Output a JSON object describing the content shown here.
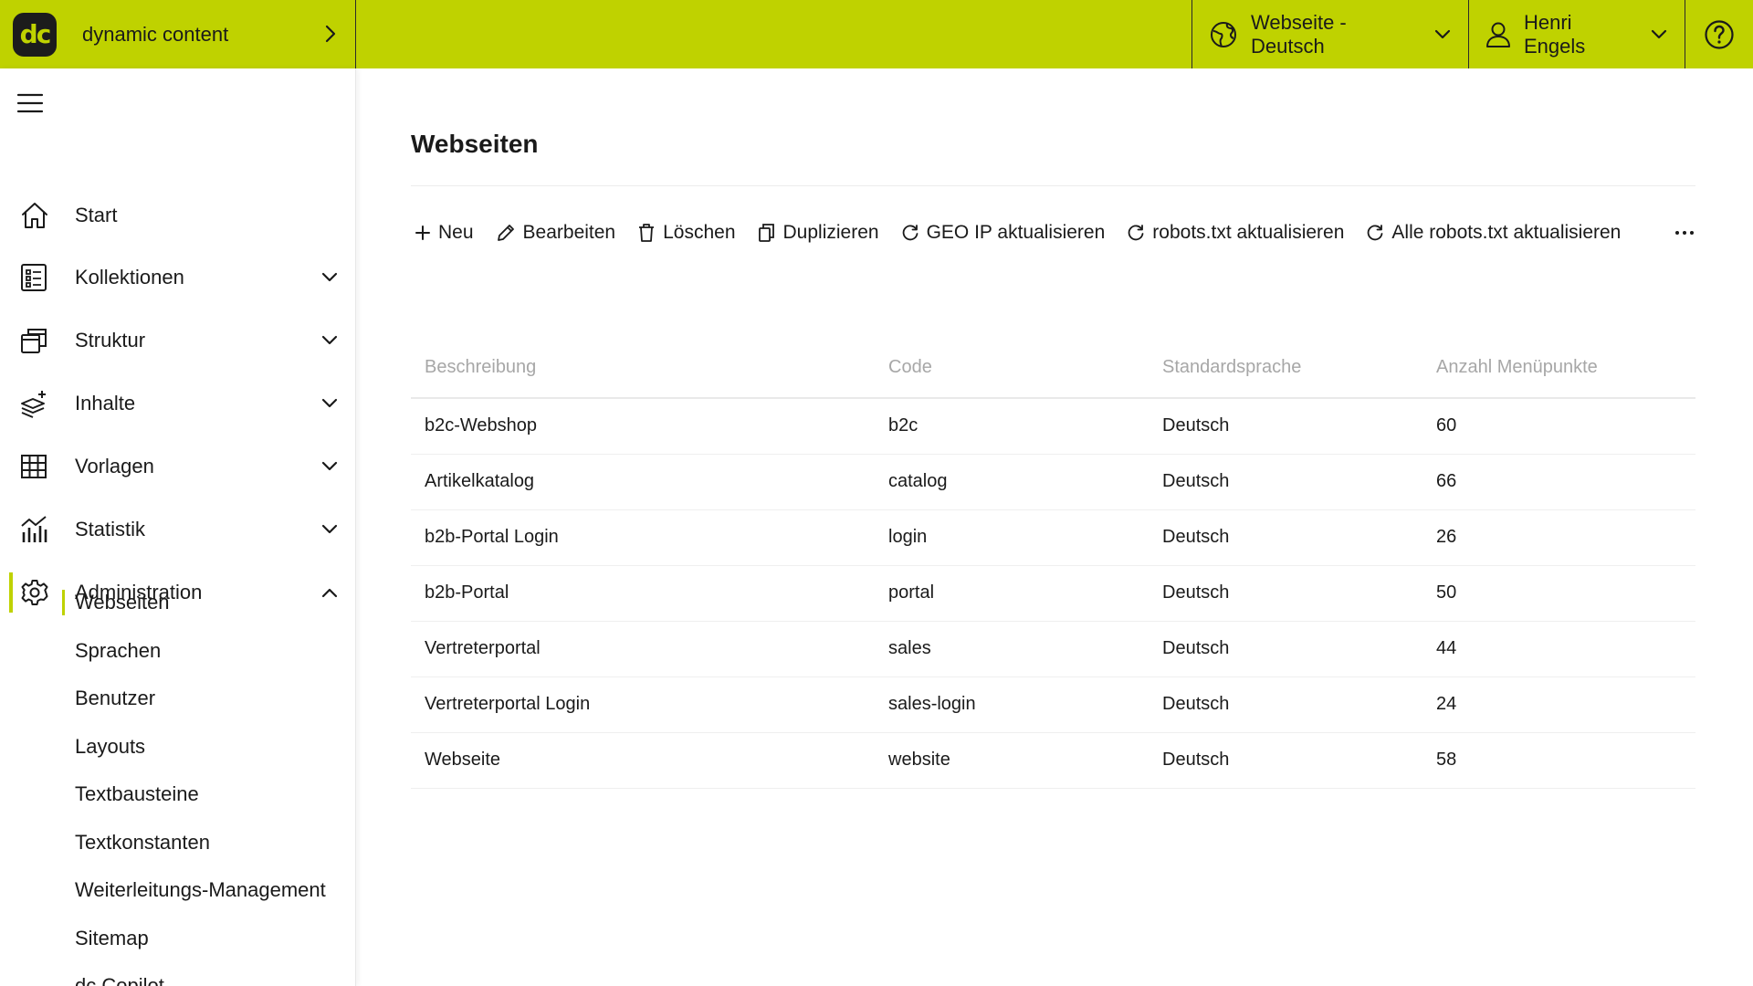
{
  "app": {
    "brand_name": "dynamic content",
    "logo_text": "dc",
    "accent_color": "#bfd200"
  },
  "header": {
    "website_selector": "Webseite - Deutsch",
    "user_name": "Henri Engels",
    "help_icon": "help-circle-icon"
  },
  "sidebar": {
    "items": [
      {
        "label": "Start",
        "icon": "home-icon"
      },
      {
        "label": "Kollektionen",
        "icon": "list-icon"
      },
      {
        "label": "Struktur",
        "icon": "windows-icon"
      },
      {
        "label": "Inhalte",
        "icon": "layers-plus-icon"
      },
      {
        "label": "Vorlagen",
        "icon": "grid-icon"
      },
      {
        "label": "Statistik",
        "icon": "chart-icon"
      },
      {
        "label": "Administration",
        "icon": "gear-icon"
      }
    ],
    "admin_subitems": [
      "Webseiten",
      "Sprachen",
      "Benutzer",
      "Layouts",
      "Textbausteine",
      "Textkonstanten",
      "Weiterleitungs-Management",
      "Sitemap",
      "dc Copilot"
    ]
  },
  "main": {
    "title": "Webseiten",
    "toolbar": {
      "new": "Neu",
      "edit": "Bearbeiten",
      "delete": "Löschen",
      "duplicate": "Duplizieren",
      "geo_ip": "GEO IP aktualisieren",
      "robots": "robots.txt aktualisieren",
      "all_robots": "Alle robots.txt aktualisieren"
    },
    "table": {
      "headers": [
        "Beschreibung",
        "Code",
        "Standardsprache",
        "Anzahl Menüpunkte"
      ],
      "rows": [
        [
          "b2c-Webshop",
          "b2c",
          "Deutsch",
          "60"
        ],
        [
          "Artikelkatalog",
          "catalog",
          "Deutsch",
          "66"
        ],
        [
          "b2b-Portal Login",
          "login",
          "Deutsch",
          "26"
        ],
        [
          "b2b-Portal",
          "portal",
          "Deutsch",
          "50"
        ],
        [
          "Vertreterportal",
          "sales",
          "Deutsch",
          "44"
        ],
        [
          "Vertreterportal Login",
          "sales-login",
          "Deutsch",
          "24"
        ],
        [
          "Webseite",
          "website",
          "Deutsch",
          "58"
        ]
      ]
    }
  }
}
